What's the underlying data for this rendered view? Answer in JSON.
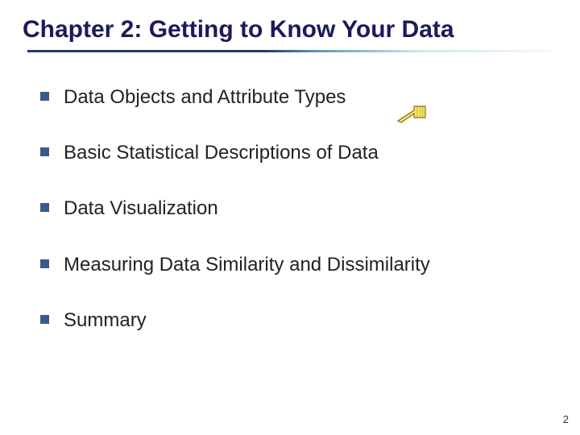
{
  "title": "Chapter 2: Getting to Know Your Data",
  "items": [
    {
      "text": "Data Objects and Attribute Types"
    },
    {
      "text": "Basic Statistical Descriptions of Data"
    },
    {
      "text": "Data Visualization"
    },
    {
      "text": "Measuring Data Similarity and Dissimilarity"
    },
    {
      "text": "Summary"
    }
  ],
  "page_number": "2"
}
